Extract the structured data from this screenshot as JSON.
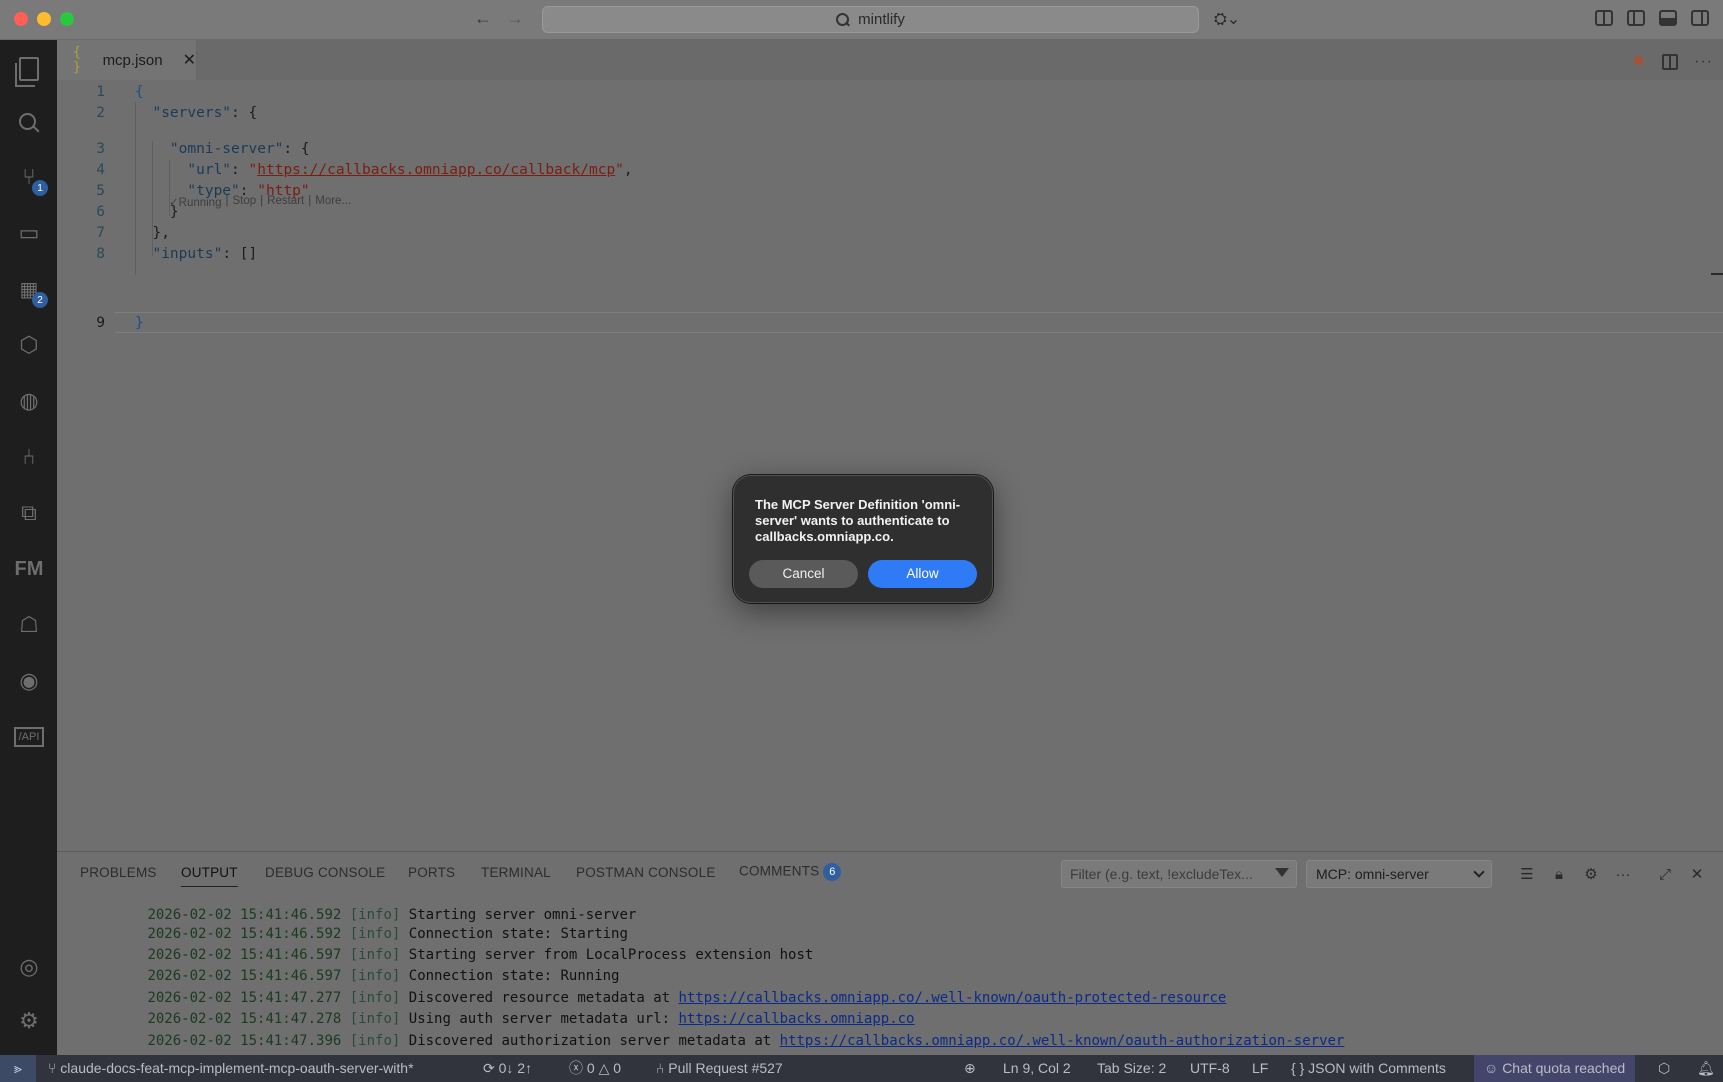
{
  "titlebar": {
    "search_text": "mintlify"
  },
  "activity_bar": {
    "source_control_badge": "1",
    "extensions_badge": "2"
  },
  "editor": {
    "tab_label": "mcp.json",
    "tab_icon": "{ }",
    "codelens": [
      "✓Running",
      "|",
      "Stop",
      "|",
      "Restart",
      "|",
      "More..."
    ],
    "lines": [
      {
        "n": "1"
      },
      {
        "n": "2"
      },
      {
        "n": "3"
      },
      {
        "n": "4"
      },
      {
        "n": "5"
      },
      {
        "n": "6"
      },
      {
        "n": "7"
      },
      {
        "n": "8"
      },
      {
        "n": "9"
      }
    ],
    "code": {
      "open": "{",
      "servers_key": "\"servers\"",
      "server_key": "\"omni-server\"",
      "url_key": "\"url\"",
      "url_value": "https://callbacks.omniapp.co/callback/mcp",
      "type_key": "\"type\"",
      "type_value": "\"http\"",
      "inputs_key": "\"inputs\"",
      "inputs_value": "[]",
      "close": "}"
    }
  },
  "panel": {
    "tabs": {
      "problems": "PROBLEMS",
      "output": "OUTPUT",
      "debug": "DEBUG CONSOLE",
      "ports": "PORTS",
      "terminal": "TERMINAL",
      "postman": "POSTMAN CONSOLE",
      "comments": "COMMENTS",
      "comments_count": "6"
    },
    "filter_placeholder": "Filter (e.g. text, !excludeTex...",
    "output_channel": "MCP: omni-server",
    "log": [
      {
        "ts": "2026-02-02 15:41:46.592",
        "lvl": "[info]",
        "msg": "Starting server omni-server",
        "url": ""
      },
      {
        "ts": "2026-02-02 15:41:46.592",
        "lvl": "[info]",
        "msg": "Connection state: Starting",
        "url": ""
      },
      {
        "ts": "2026-02-02 15:41:46.597",
        "lvl": "[info]",
        "msg": "Starting server from LocalProcess extension host",
        "url": ""
      },
      {
        "ts": "2026-02-02 15:41:46.597",
        "lvl": "[info]",
        "msg": "Connection state: Running",
        "url": ""
      },
      {
        "ts": "2026-02-02 15:41:47.277",
        "lvl": "[info]",
        "msg": "Discovered resource metadata at ",
        "url": "https://callbacks.omniapp.co/.well-known/oauth-protected-resource"
      },
      {
        "ts": "2026-02-02 15:41:47.278",
        "lvl": "[info]",
        "msg": "Using auth server metadata url: ",
        "url": "https://callbacks.omniapp.co"
      },
      {
        "ts": "2026-02-02 15:41:47.396",
        "lvl": "[info]",
        "msg": "Discovered authorization server metadata at ",
        "url": "https://callbacks.omniapp.co/.well-known/oauth-authorization-server"
      }
    ]
  },
  "statusbar": {
    "branch": "claude-docs-feat-mcp-implement-mcp-oauth-server-with*",
    "sync": "0↓ 2↑",
    "errors": "0",
    "warnings": "0",
    "pull_request": "Pull Request #527",
    "position": "Ln 9, Col 2",
    "tab_size": "Tab Size: 2",
    "encoding": "UTF-8",
    "eol": "LF",
    "language": "JSON with Comments",
    "language_icon": "{ }",
    "chat_quota": "Chat quota reached"
  },
  "dialog": {
    "message": "The MCP Server Definition 'omni-server' wants to authenticate to callbacks.omniapp.co.",
    "cancel_label": "Cancel",
    "allow_label": "Allow"
  },
  "colors": {
    "allow_button": "#2f7bf5",
    "status_bar": "#31343d",
    "badge": "#2f5f9e"
  }
}
